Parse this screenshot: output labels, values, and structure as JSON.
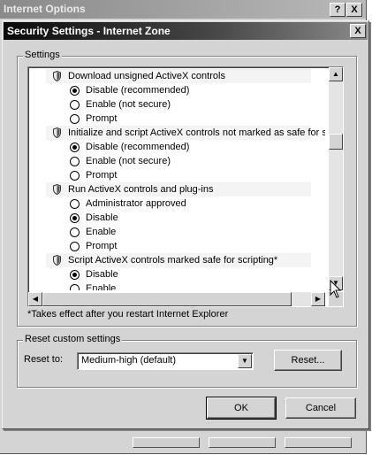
{
  "parent_window": {
    "title": "Internet Options",
    "help_label": "?",
    "close_label": "X"
  },
  "dialog": {
    "title": "Security Settings - Internet Zone",
    "close_label": "X"
  },
  "settings_group": {
    "label": "Settings",
    "items": [
      {
        "type": "header",
        "label": "Download unsigned ActiveX controls"
      },
      {
        "type": "option",
        "label": "Disable (recommended)",
        "selected": true
      },
      {
        "type": "option",
        "label": "Enable (not secure)",
        "selected": false
      },
      {
        "type": "option",
        "label": "Prompt",
        "selected": false
      },
      {
        "type": "header",
        "label": "Initialize and script ActiveX controls not marked as safe for sc"
      },
      {
        "type": "option",
        "label": "Disable (recommended)",
        "selected": true
      },
      {
        "type": "option",
        "label": "Enable (not secure)",
        "selected": false
      },
      {
        "type": "option",
        "label": "Prompt",
        "selected": false
      },
      {
        "type": "header",
        "label": "Run ActiveX controls and plug-ins"
      },
      {
        "type": "option",
        "label": "Administrator approved",
        "selected": false
      },
      {
        "type": "option",
        "label": "Disable",
        "selected": true
      },
      {
        "type": "option",
        "label": "Enable",
        "selected": false
      },
      {
        "type": "option",
        "label": "Prompt",
        "selected": false
      },
      {
        "type": "header",
        "label": "Script ActiveX controls marked safe for scripting*"
      },
      {
        "type": "option",
        "label": "Disable",
        "selected": true
      },
      {
        "type": "option",
        "label": "Enable",
        "selected": false
      }
    ],
    "note": "*Takes effect after you restart Internet Explorer"
  },
  "reset_group": {
    "label": "Reset custom settings",
    "reset_to_label": "Reset to:",
    "selected_value": "Medium-high (default)",
    "reset_button": "Reset..."
  },
  "buttons": {
    "ok": "OK",
    "cancel": "Cancel"
  },
  "icons": {
    "setting_icon": "shield-icon",
    "scroll_up": "arrow-up-icon",
    "scroll_down": "arrow-down-icon",
    "scroll_left": "arrow-left-icon",
    "scroll_right": "arrow-right-icon",
    "cursor": "mouse-cursor-icon"
  }
}
